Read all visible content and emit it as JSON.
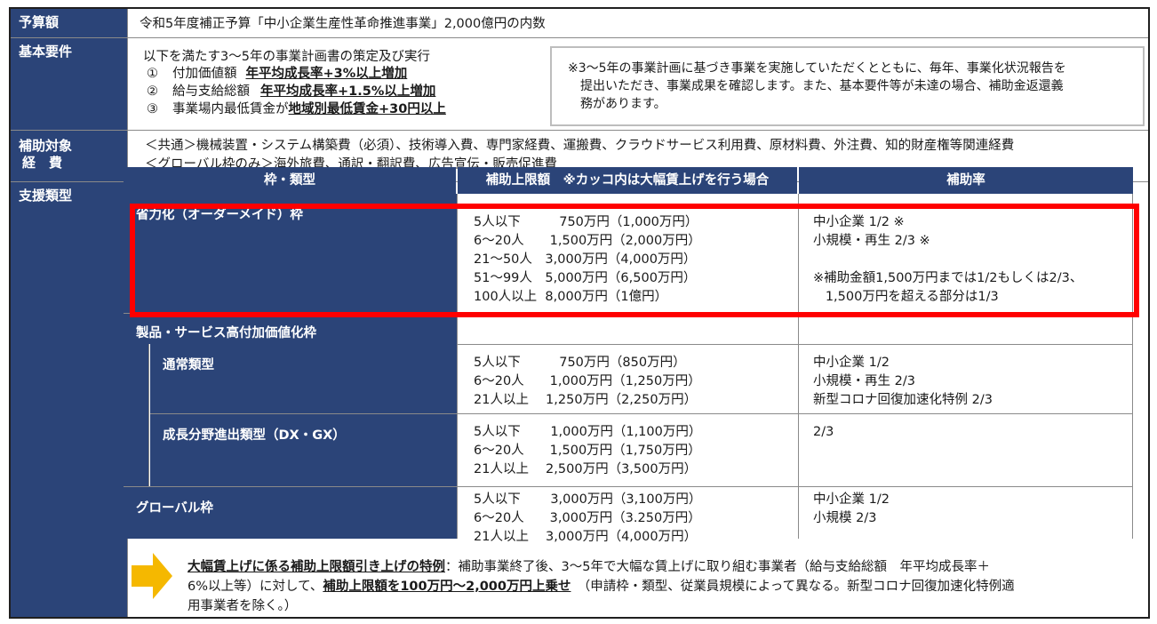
{
  "rows": {
    "budget": {
      "label": "予算額",
      "text": "令和5年度補正予算「中小企業生産性革命推進事業」2,000億円の内数"
    },
    "requirements": {
      "label": "基本要件",
      "intro": "以下を満たす3～5年の事業計画書の策定及び実行",
      "items": [
        {
          "num": "①",
          "name": "付加価値額",
          "value": "年平均成長率+3%以上増加"
        },
        {
          "num": "②",
          "name": "給与支給総額",
          "value": "年平均成長率+1.5%以上増加"
        },
        {
          "num": "③",
          "name": "事業場内最低賃金が",
          "value": "地域別最低賃金+30円以上"
        }
      ],
      "note_lines": [
        "※3～5年の事業計画に基づき事業を実施していただくとともに、毎年、事業化状況報告を",
        "提出いただき、事業成果を確認します。また、基本要件等が未達の場合、補助金返還義",
        "務があります。"
      ]
    },
    "costs": {
      "label_line1": "補助対象",
      "label_line2": "経　費",
      "line1": "＜共通＞機械装置・システム構築費（必須）、技術導入費、専門家経費、運搬費、クラウドサービス利用費、原材料費、外注費、知的財産権等関連経費",
      "line2": "＜グローバル枠のみ＞海外旅費、通訳・翻訳費、広告宣伝・販売促進費"
    },
    "support": {
      "label": "支援類型"
    }
  },
  "table": {
    "headers": [
      "枠・類型",
      "補助上限額　※カッコ内は大幅賃上げを行う場合",
      "補助率"
    ],
    "shoryokuka": {
      "name": "省力化（オーダーメイド）枠",
      "limits": [
        "5人以下　　　750万円（1,000万円）",
        "6～20人　　1,500万円（2,000万円）",
        "21～50人　3,000万円（4,000万円）",
        "51～99人　5,000万円（6,500万円）",
        "100人以上  8,000万円（1億円）"
      ],
      "rates": [
        "中小企業 1/2 ※",
        "小規模・再生 2/3 ※",
        "",
        "※補助金額1,500万円までは1/2もしくは2/3、",
        "   1,500万円を超える部分は1/3"
      ]
    },
    "product_service": {
      "name": "製品・サービス高付加価値化枠"
    },
    "tsujo": {
      "name": "通常類型",
      "limits": [
        "5人以下　　　750万円（850万円）",
        "6～20人　　1,000万円（1,250万円）",
        "21人以上　 1,250万円（2,250万円）"
      ],
      "rates": [
        "中小企業 1/2",
        "小規模・再生 2/3",
        "新型コロナ回復加速化特例 2/3"
      ]
    },
    "seicho": {
      "name": "成長分野進出類型（DX・GX）",
      "limits": [
        "5人以下　　 1,000万円（1,100万円）",
        "6～20人　　1,500万円（1,750万円）",
        "21人以上　 2,500万円（3,500万円）"
      ],
      "rates": [
        "2/3"
      ]
    },
    "global": {
      "name": "グローバル枠",
      "limits": [
        "5人以下　　 3,000万円（3,100万円）",
        "6～20人　　3,000万円（3.250万円）",
        "21人以上　 3,000万円（4,000万円）"
      ],
      "rates": [
        "中小企業 1/2",
        "小規模 2/3"
      ]
    }
  },
  "special": {
    "title": "大幅賃上げに係る補助上限額引き上げの特例",
    "text1": "：補助事業終了後、3～5年で大幅な賃上げに取り組む事業者（給与支給総額　年平均成長率＋",
    "text2a": "6%以上等）に対して、",
    "emph": "補助上限額を100万円～2,000万円上乗せ",
    "text2b": "　（申請枠・類型、従業員規模によって異なる。新型コロナ回復加速化特例適",
    "text3": "用事業者を除く。）"
  },
  "colors": {
    "header_bg": "#2b4478",
    "highlight": "#ff0000",
    "arrow": "#f5b800"
  }
}
